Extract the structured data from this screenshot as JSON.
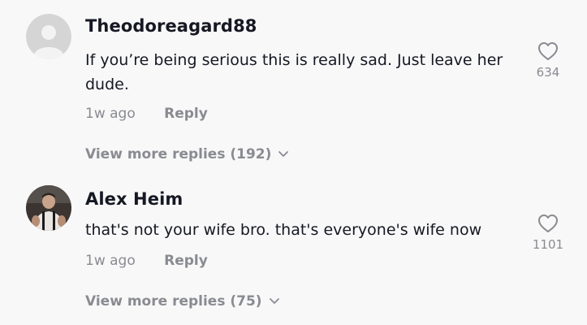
{
  "comments": [
    {
      "username": "Theodoreagard88",
      "text": "If you’re being serious this is really sad. Just leave her dude.",
      "time": "1w ago",
      "reply_label": "Reply",
      "view_more": "View more replies (192)",
      "likes": "634",
      "avatar": "default-avatar-icon"
    },
    {
      "username": "Alex Heim",
      "text": "that's not your wife bro. that's everyone's wife now",
      "time": "1w ago",
      "reply_label": "Reply",
      "view_more": "View more replies (75)",
      "likes": "1101",
      "avatar": "user-photo-avatar"
    }
  ],
  "colors": {
    "background": "#f8f8f8",
    "primary_text": "#161823",
    "secondary_text": "#8a8b91",
    "avatar_placeholder": "#d5d5d6"
  }
}
